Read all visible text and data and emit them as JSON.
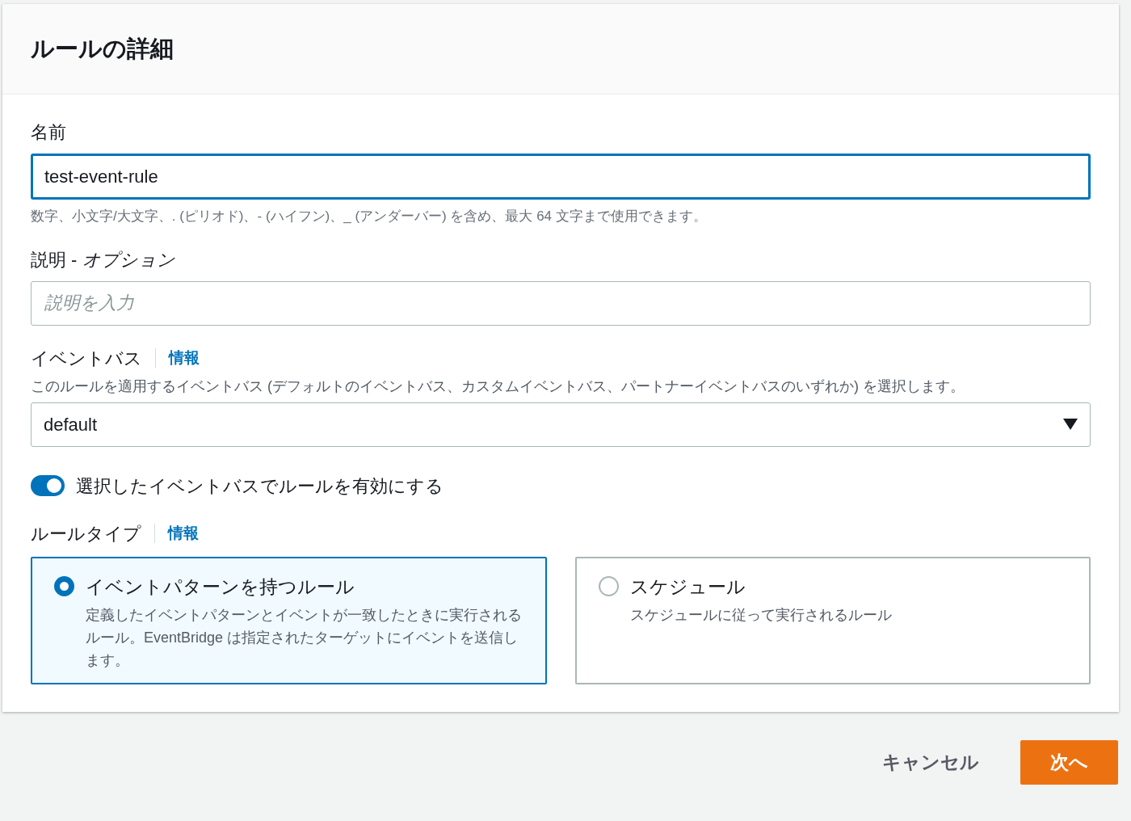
{
  "panel": {
    "title": "ルールの詳細"
  },
  "name_field": {
    "label": "名前",
    "value": "test-event-rule",
    "focused": true,
    "hint": "数字、小文字/大文字、. (ピリオド)、- (ハイフン)、_ (アンダーバー) を含め、最大 64 文字まで使用できます。"
  },
  "description_field": {
    "label": "説明 - *オプション*",
    "placeholder": "説明を入力"
  },
  "event_bus": {
    "label": "イベントバス",
    "info_link": "情報",
    "description": "このルールを適用するイベントバス (デフォルトのイベントバス、カスタムイベントバス、パートナーイベントバスのいずれか) を選択します。",
    "value": "default"
  },
  "enable_toggle": {
    "label": "選択したイベントバスでルールを有効にする",
    "on": true
  },
  "rule_type": {
    "label": "ルールタイプ",
    "info_link": "情報",
    "options": [
      {
        "title": "イベントパターンを持つルール",
        "description": "定義したイベントパターンとイベントが一致したときに実行されるルール。EventBridge は指定されたターゲットにイベントを送信します。",
        "selected": true
      },
      {
        "title": "スケジュール",
        "description": "スケジュールに従って実行されるルール",
        "selected": false
      }
    ]
  },
  "buttons": [
    {
      "label": "キャンセル",
      "kind": "secondary"
    },
    {
      "label": "次へ",
      "kind": "primary"
    }
  ]
}
